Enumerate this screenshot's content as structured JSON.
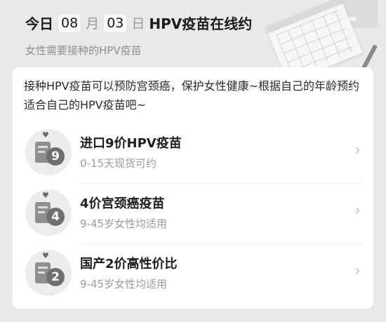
{
  "header": {
    "prefix": "今日",
    "month": "08",
    "month_unit": "月",
    "day": "03",
    "day_unit": "日",
    "title": "HPV疫苗在线约",
    "subtitle": "女性需要接种的HPV疫苗"
  },
  "description": "接种HPV疫苗可以预防宫颈癌，保护女性健康~根据自己的年龄预约适合自己的HPV疫苗吧~",
  "vaccines": [
    {
      "badge": "9",
      "title": "进口9价HPV疫苗",
      "subtitle": "0-15天现货可约",
      "icon": "vaccine-9-icon"
    },
    {
      "badge": "4",
      "title": "4价宫颈癌疫苗",
      "subtitle": "9-45岁女性均适用",
      "icon": "vaccine-4-icon"
    },
    {
      "badge": "2",
      "title": "国产2价高性价比",
      "subtitle": "9-45岁女性均适用",
      "icon": "vaccine-2-icon"
    }
  ],
  "colors": {
    "background": "#e9e9e9",
    "card": "#ffffff",
    "muted_text": "#9a9a9a"
  }
}
